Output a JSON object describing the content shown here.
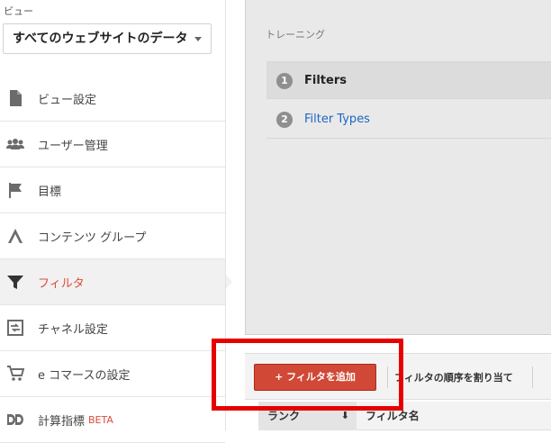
{
  "sidebar": {
    "view_label": "ビュー",
    "view_select": "すべてのウェブサイトのデータ",
    "items": [
      {
        "label": "ビュー設定",
        "icon": "document-icon"
      },
      {
        "label": "ユーザー管理",
        "icon": "people-icon"
      },
      {
        "label": "目標",
        "icon": "flag-icon"
      },
      {
        "label": "コンテンツ グループ",
        "icon": "content-group-icon"
      },
      {
        "label": "フィルタ",
        "icon": "filter-icon",
        "active": true
      },
      {
        "label": "チャネル設定",
        "icon": "channel-icon"
      },
      {
        "label": "e コマースの設定",
        "icon": "cart-icon"
      },
      {
        "label": "計算指標",
        "badge": "BETA",
        "icon": "calculated-metrics-icon"
      }
    ]
  },
  "main": {
    "training_label": "トレーニング",
    "steps": [
      {
        "num": "1",
        "label": "Filters"
      },
      {
        "num": "2",
        "label": "Filter Types"
      }
    ],
    "toolbar": {
      "add_filter": "+ フィルタを追加",
      "assign_order": "フィルタの順序を割り当て"
    },
    "table": {
      "headers": [
        "ランク",
        "フィルタ名"
      ],
      "sort_indicator": "⬇"
    }
  },
  "colors": {
    "accent_red": "#d14836",
    "link_blue": "#1a66c4",
    "highlight": "#e60000",
    "top_bar": "#4d90fe"
  }
}
